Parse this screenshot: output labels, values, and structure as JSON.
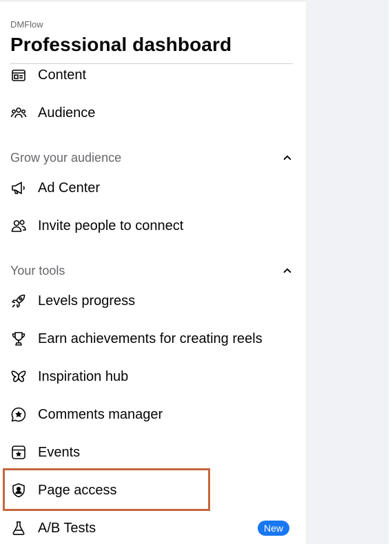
{
  "header": {
    "app_name": "DMFlow",
    "title": "Professional dashboard"
  },
  "menu_top": [
    {
      "label": "Content",
      "icon": "content-icon"
    },
    {
      "label": "Audience",
      "icon": "audience-icon"
    }
  ],
  "sections": {
    "grow": {
      "title": "Grow your audience",
      "expanded": true,
      "items": [
        {
          "label": "Ad Center",
          "icon": "megaphone-icon"
        },
        {
          "label": "Invite people to connect",
          "icon": "people-icon"
        }
      ]
    },
    "tools": {
      "title": "Your tools",
      "expanded": true,
      "items": [
        {
          "label": "Levels progress",
          "icon": "rocket-icon"
        },
        {
          "label": "Earn achievements for creating reels",
          "icon": "trophy-icon"
        },
        {
          "label": "Inspiration hub",
          "icon": "butterfly-icon"
        },
        {
          "label": "Comments manager",
          "icon": "comment-star-icon"
        },
        {
          "label": "Events",
          "icon": "calendar-star-icon"
        },
        {
          "label": "Page access",
          "icon": "shield-user-icon",
          "highlighted": true
        },
        {
          "label": "A/B Tests",
          "icon": "flask-icon",
          "badge": "New"
        }
      ]
    }
  },
  "colors": {
    "accent": "#1877f2",
    "highlight_border": "#c5673e",
    "secondary_text": "#65676b",
    "panel_background": "#f0f2f5"
  }
}
